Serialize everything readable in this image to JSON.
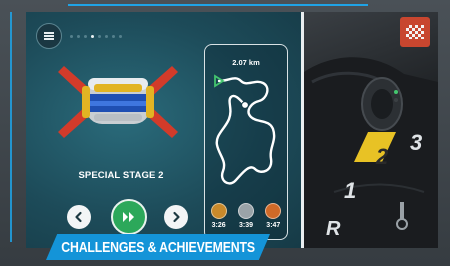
{
  "menu": {
    "icon": "hamburger-menu-icon"
  },
  "pager": {
    "total": 8,
    "active_index": 3
  },
  "stage": {
    "title": "SPECIAL STAGE 2"
  },
  "controls": {
    "prev_icon": "chevron-left-icon",
    "play_icon": "fast-forward-icon",
    "next_icon": "chevron-right-icon"
  },
  "track": {
    "distance": "2.07 km",
    "medals": [
      {
        "tier": "gold",
        "color": "#c98a2b",
        "time": "3:26"
      },
      {
        "tier": "silver",
        "color": "#9aa3a8",
        "time": "3:39"
      },
      {
        "tier": "bronze",
        "color": "#d06a28",
        "time": "3:47"
      }
    ]
  },
  "cockpit": {
    "gears": [
      "1",
      "2",
      "3",
      "R"
    ],
    "active_gear": "2",
    "flag_icon": "checkered-flag-icon",
    "accent": "#e8c225"
  },
  "banner": {
    "text": "CHALLENGES & ACHIEVEMENTS"
  },
  "colors": {
    "hud_blue": "#1fa3e6",
    "play_green": "#2ca85a",
    "flag_red": "#c8462f"
  }
}
